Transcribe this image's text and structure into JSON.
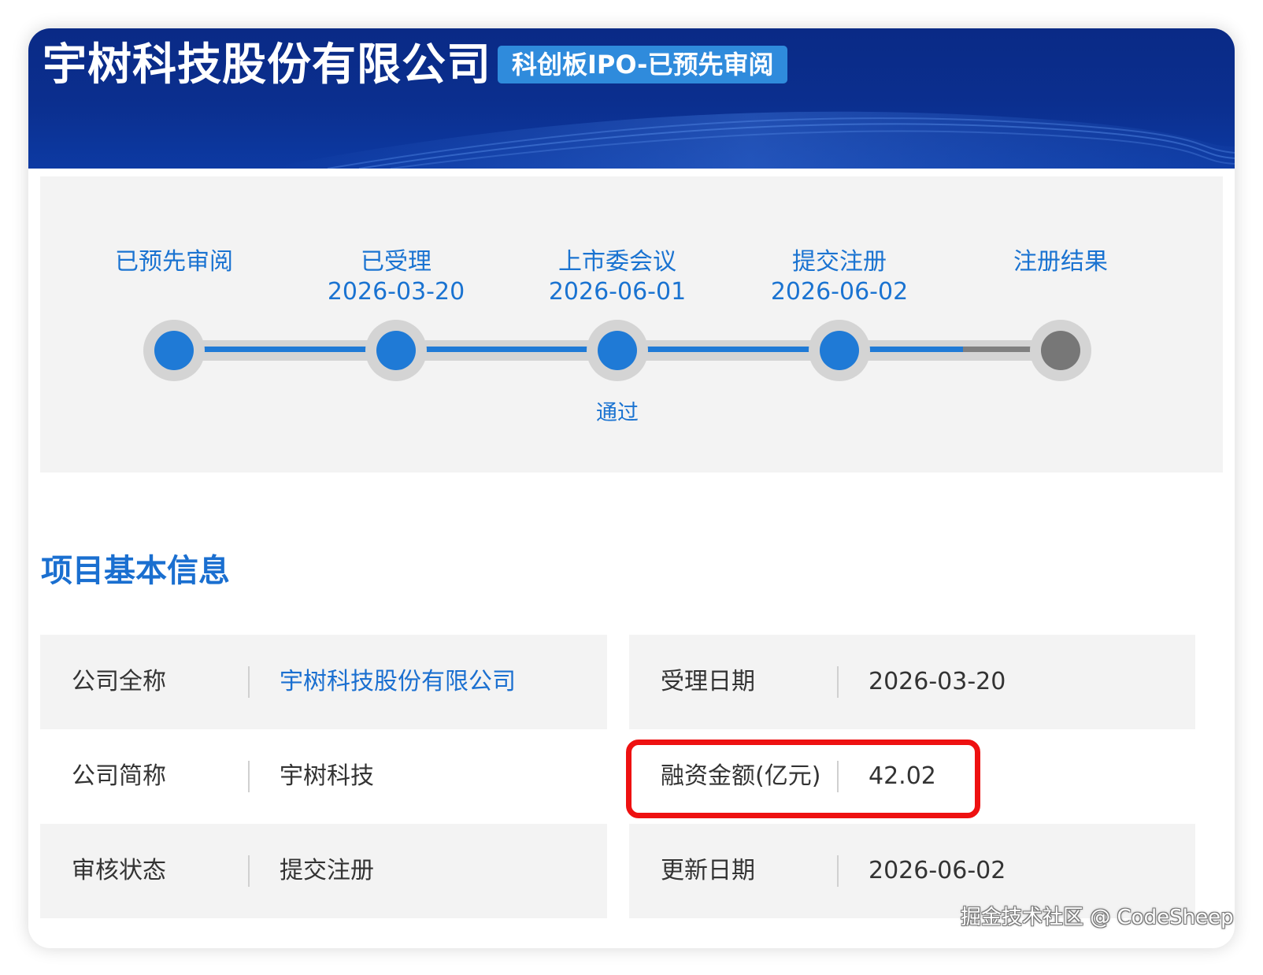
{
  "header": {
    "company_name": "宇树科技股份有限公司",
    "board_badge": "科创板IPO-已预先审阅"
  },
  "progress": {
    "steps": [
      {
        "name": "已预先审阅",
        "date": "",
        "status": "completed",
        "result": ""
      },
      {
        "name": "已受理",
        "date": "2026-03-20",
        "status": "completed",
        "result": ""
      },
      {
        "name": "上市委会议",
        "date": "2026-06-01",
        "status": "completed",
        "result": "通过"
      },
      {
        "name": "提交注册",
        "date": "2026-06-02",
        "status": "completed",
        "result": ""
      },
      {
        "name": "注册结果",
        "date": "",
        "status": "pending",
        "result": ""
      }
    ],
    "completed_fraction": 0.88
  },
  "section": {
    "title": "项目基本信息"
  },
  "info": {
    "rows": [
      {
        "left": {
          "label": "公司全称",
          "value": "宇树科技股份有限公司"
        },
        "right": {
          "label": "受理日期",
          "value": "2026-03-20"
        }
      },
      {
        "left": {
          "label": "公司简称",
          "value": "宇树科技"
        },
        "right": {
          "label": "融资金额(亿元)",
          "value": "42.02"
        }
      },
      {
        "left": {
          "label": "审核状态",
          "value": "提交注册"
        },
        "right": {
          "label": "更新日期",
          "value": "2026-06-02"
        }
      }
    ]
  },
  "watermark": "掘金技术社区 @ CodeSheep",
  "colors": {
    "header_bg": "#0b2f8f",
    "accent": "#1a6fd0",
    "badge_bg": "#2f8bdc",
    "highlight": "#ee1111",
    "panel_bg": "#f3f3f3"
  }
}
